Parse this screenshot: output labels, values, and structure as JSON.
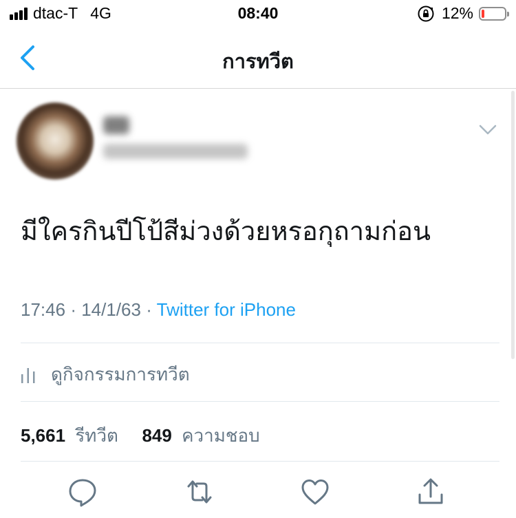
{
  "status_bar": {
    "carrier": "dtac-T",
    "network": "4G",
    "time": "08:40",
    "battery_percent": "12%",
    "battery_level": 0.12,
    "icons": [
      "signal-bars-icon",
      "orientation-lock-icon",
      "battery-icon"
    ]
  },
  "nav": {
    "title": "การทวีต",
    "back_icon": "chevron-left-icon"
  },
  "tweet": {
    "text": "มีใครกินปีโป้สีม่วงด้วยหรอกุถามก่อน",
    "time": "17:46",
    "date": "14/1/63",
    "separator": "·",
    "source": "Twitter for iPhone",
    "activity_label": "ดูกิจกรรมการทวีต",
    "retweets_count": "5,661",
    "retweets_label": "รีทวีต",
    "likes_count": "849",
    "likes_label": "ความชอบ"
  },
  "actions": [
    "reply-icon",
    "retweet-icon",
    "like-icon",
    "share-icon"
  ],
  "colors": {
    "accent": "#1da1f2",
    "text": "#14171a",
    "secondary": "#657786",
    "battery_low": "#ff3b30"
  }
}
